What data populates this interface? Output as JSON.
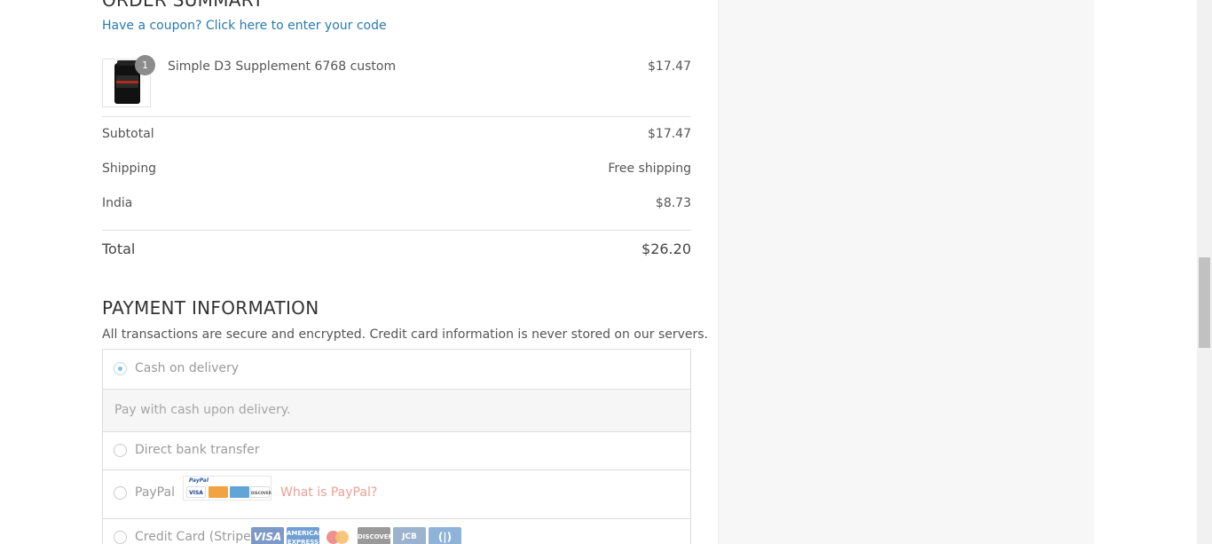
{
  "order_summary": {
    "title": "ORDER SUMMARY",
    "coupon_link": "Have a coupon? Click here to enter your code",
    "item": {
      "quantity": "1",
      "name": "Simple D3 Supplement 6768 custom",
      "price": "$17.47"
    },
    "subtotal_label": "Subtotal",
    "subtotal_value": "$17.47",
    "shipping_label": "Shipping",
    "shipping_value": "Free shipping",
    "tax_label": "India",
    "tax_value": "$8.73",
    "total_label": "Total",
    "total_value": "$26.20"
  },
  "payment": {
    "title": "PAYMENT INFORMATION",
    "note": "All transactions are secure and encrypted. Credit card information is never stored on our servers.",
    "methods": [
      {
        "label": "Cash on delivery",
        "selected": true,
        "description": "Pay with cash upon delivery."
      },
      {
        "label": "Direct bank transfer",
        "selected": false
      },
      {
        "label": "PayPal",
        "selected": false,
        "link": "What is PayPal?"
      },
      {
        "label": "Credit Card (Stripe)",
        "selected": false
      }
    ],
    "paypal_logo_text": "PayPal",
    "paypal_mini_cards": [
      "VISA",
      "",
      "",
      "DISCOVER"
    ],
    "card_logos": [
      "VISA",
      "AMERICAN EXPRESS",
      "",
      "DISCOVER",
      "JCB",
      "(|)"
    ]
  },
  "colors": {
    "link": "#2a7ab0",
    "paypal_link": "#eaa096",
    "radio_selected": "#7fc2dc"
  }
}
